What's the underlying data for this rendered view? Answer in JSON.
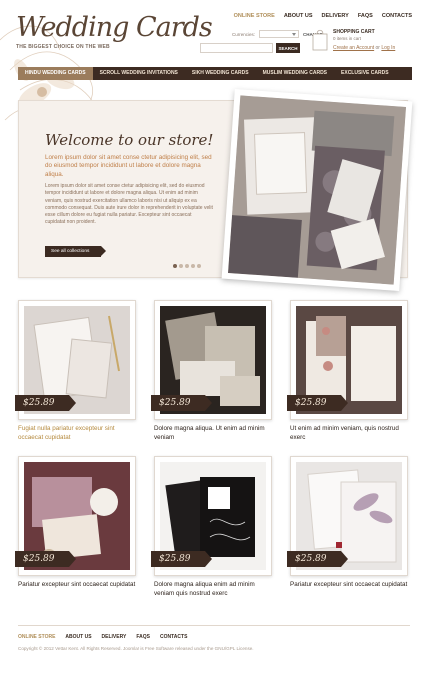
{
  "header": {
    "logo": "Wedding Cards",
    "tagline": "THE BIGGEST CHOICE ON THE WEB",
    "top_nav": [
      "ONLINE STORE",
      "ABOUT US",
      "DELIVERY",
      "FAQS",
      "CONTACTS"
    ],
    "currencies_label": "Currencies:",
    "change_label": "CHANGE",
    "search_button": "SEARCH",
    "cart": {
      "title": "SHOPPING CART",
      "items": "0 items in cart",
      "create_account": "Create an Account",
      "or": "or",
      "login": "Log In"
    }
  },
  "main_nav": [
    "HINDU WEDDING CARDS",
    "SCROLL WEDDING INVITATIONS",
    "SIKH WEDDING CARDS",
    "MUSLIM WEDDING CARDS",
    "EXCLUSIVE CARDS"
  ],
  "slider": {
    "welcome": "Welcome to our store!",
    "lead": "Lorem ipsum dolor sit amet conse ctetur adipisicing elit, sed do eiusmod tempor incididunt ut labore et dolore magna aliqua.",
    "body": "Lorem ipsum dolor sit amet conse ctetur adipisicing elit, sed do eiusmod tempor incididunt ut labore et dolore magna aliqua. Ut enim ad minim veniam, quis nostrud exercitation ullamco laboris nisi ut aliquip ex ea commodo consequat. Duis aute irure dolor in reprehenderit in voluptate velit esse cillum dolore eu fugiat nulla pariatur. Excepteur sint occaecat cupidatat non proident.",
    "button": "See all collections",
    "active_slide": 1,
    "slide_count": 5
  },
  "products": [
    {
      "price": "$25.89",
      "title": "Fugiat nulla pariatur excepteur sint occaecat cupidatat"
    },
    {
      "price": "$25.89",
      "title": "Dolore magna aliqua. Ut enim ad minim veniam"
    },
    {
      "price": "$25.89",
      "title": "Ut enim ad minim veniam, quis nostrud exerc"
    },
    {
      "price": "$25.89",
      "title": "Pariatur excepteur sint occaecat cupidatat"
    },
    {
      "price": "$25.89",
      "title": "Dolore magna aliqua enim ad minim veniam quis nostrud exerc"
    },
    {
      "price": "$25.89",
      "title": "Pariatur excepteur sint occaecat cupidatat"
    }
  ],
  "footer": {
    "nav": [
      "ONLINE STORE",
      "ABOUT US",
      "DELIVERY",
      "FAQS",
      "CONTACTS"
    ],
    "copyright": "Copyright © 2012 Vettar Kent. All Rights Reserved. Joomla! is Free Software released under the GNU/GPL License."
  },
  "colors": {
    "dark_brown": "#3d2b22",
    "accent_gold": "#b08f5a",
    "lead_orange": "#bf7e47"
  }
}
